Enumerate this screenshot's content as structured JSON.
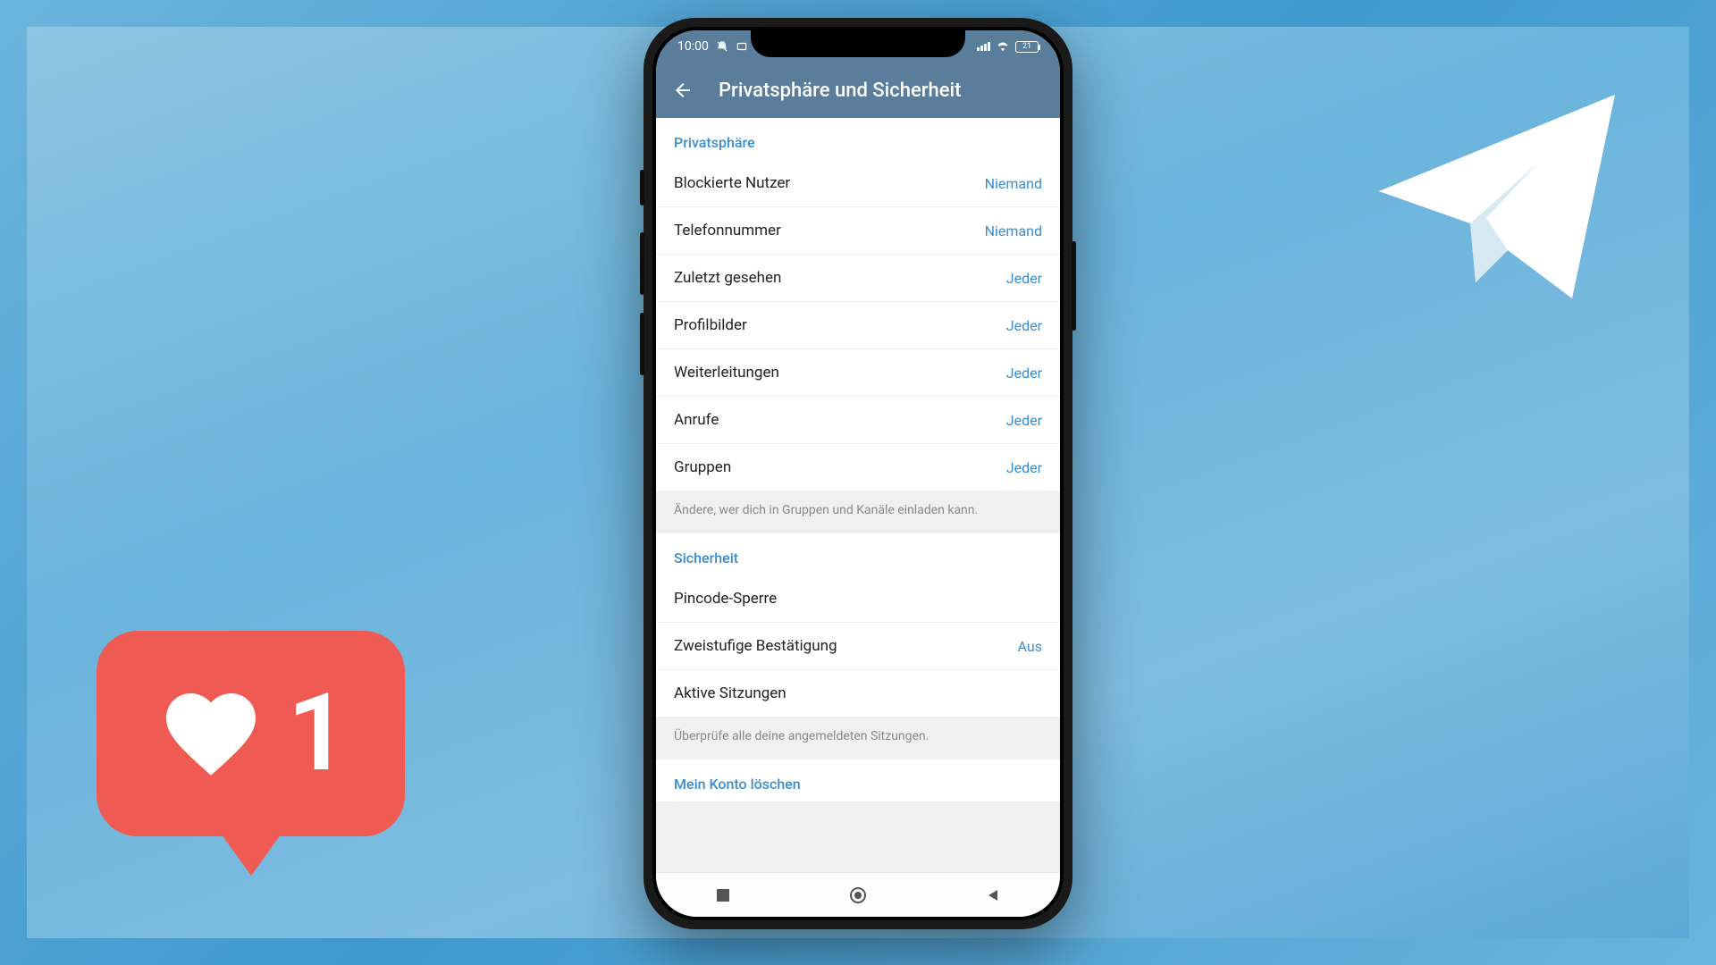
{
  "status": {
    "time": "10:00",
    "battery": "21"
  },
  "header": {
    "title": "Privatsphäre und Sicherheit"
  },
  "privacy": {
    "title": "Privatsphäre",
    "items": [
      {
        "label": "Blockierte Nutzer",
        "value": "Niemand"
      },
      {
        "label": "Telefonnummer",
        "value": "Niemand"
      },
      {
        "label": "Zuletzt gesehen",
        "value": "Jeder"
      },
      {
        "label": "Profilbilder",
        "value": "Jeder"
      },
      {
        "label": "Weiterleitungen",
        "value": "Jeder"
      },
      {
        "label": "Anrufe",
        "value": "Jeder"
      },
      {
        "label": "Gruppen",
        "value": "Jeder"
      }
    ],
    "footer": "Ändere, wer dich in Gruppen und Kanäle einladen kann."
  },
  "security": {
    "title": "Sicherheit",
    "items": [
      {
        "label": "Pincode-Sperre",
        "value": ""
      },
      {
        "label": "Zweistufige Bestätigung",
        "value": "Aus"
      },
      {
        "label": "Aktive Sitzungen",
        "value": ""
      }
    ],
    "footer": "Überprüfe alle deine angemeldeten Sitzungen."
  },
  "delete": {
    "title": "Mein Konto löschen"
  },
  "like": {
    "count": "1"
  }
}
